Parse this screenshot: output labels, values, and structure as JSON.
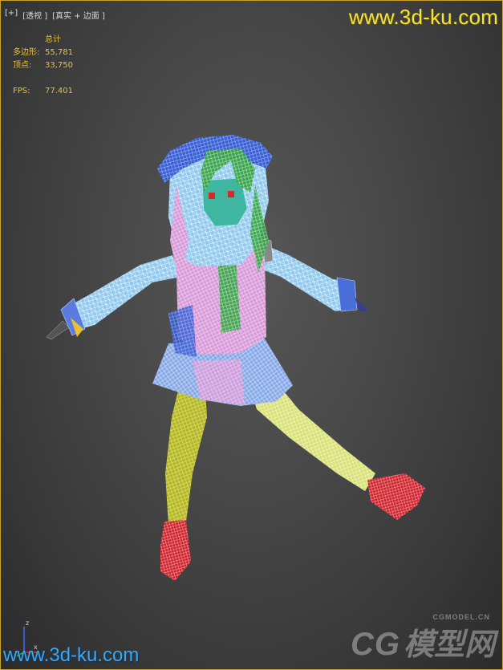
{
  "viewport": {
    "labels": [
      "[+]",
      "[透视 ]",
      "[真实 + 边面 ]"
    ],
    "stats": {
      "title": "总计",
      "polygons_label": "多边形:",
      "polygons_value": "55,781",
      "vertices_label": "顶点:",
      "vertices_value": "33,750",
      "fps_label": "FPS:",
      "fps_value": "77.401"
    },
    "border_color": "#c9a227"
  },
  "watermarks": {
    "top": "www.3d-ku.com",
    "bottom": "www.3d-ku.com",
    "cg_small": "CGMODEL.CN",
    "cg_big": "CG",
    "cg_cn": "模型网"
  },
  "axis": {
    "z": "z",
    "x": "x"
  }
}
